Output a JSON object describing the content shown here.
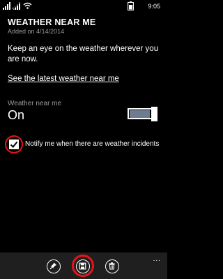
{
  "status_bar": {
    "time": "9:05"
  },
  "header": {
    "title": "WEATHER NEAR ME",
    "subtitle": "Added on 4/14/2014"
  },
  "main": {
    "description": "Keep an eye on the weather wherever you are now.",
    "link_label": "See the latest weather near me",
    "toggle": {
      "label": "Weather near me",
      "state_label": "On",
      "is_on": true
    },
    "notify": {
      "label": "Notify me when there are weather incidents",
      "checked": true
    }
  },
  "app_bar": {
    "buttons": [
      {
        "name": "pin",
        "icon": "pin-icon"
      },
      {
        "name": "save",
        "icon": "save-icon"
      },
      {
        "name": "delete",
        "icon": "trash-icon"
      }
    ],
    "more": "..."
  },
  "colors": {
    "background": "#000000",
    "app_bar_bg": "#1f1f1f",
    "toggle_fill": "#6d7c8e",
    "highlight_ring": "#e6141a",
    "secondary_text": "#9a9a9a"
  }
}
